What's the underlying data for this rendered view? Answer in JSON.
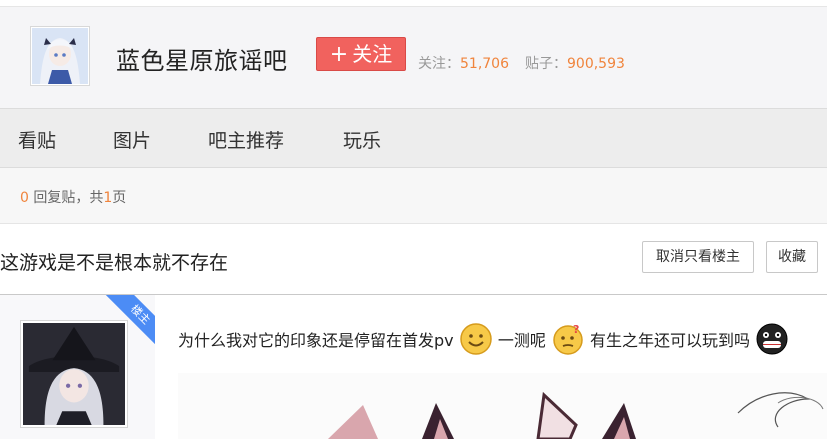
{
  "forum": {
    "name": "蓝色星原旅谣吧",
    "follow_label": "关注",
    "follow_icon": "plus-icon",
    "followers_label": "关注：",
    "followers_value": "51,706",
    "posts_label": "贴子：",
    "posts_value": "900,593"
  },
  "nav": {
    "items": [
      {
        "label": "看贴"
      },
      {
        "label": "图片"
      },
      {
        "label": "吧主推荐"
      },
      {
        "label": "玩乐"
      }
    ]
  },
  "reply_info": {
    "count": "0",
    "text1": "回复贴，共",
    "pages": "1",
    "text2": "页"
  },
  "thread": {
    "title": "这游戏是不是根本就不存在",
    "only_op_button": "取消只看楼主",
    "favorite_button": "收藏"
  },
  "post": {
    "badge": "楼主",
    "text_part1": "为什么我对它的印象还是停留在首发pv",
    "text_part2": "一测呢",
    "text_part3": "有生之年还可以玩到吗",
    "emojis": [
      "smile-emoji",
      "confused-emoji",
      "grin-black-emoji"
    ]
  },
  "colors": {
    "accent": "#f1625e",
    "stat_number": "#f0843c",
    "badge": "#4c8cf5"
  }
}
